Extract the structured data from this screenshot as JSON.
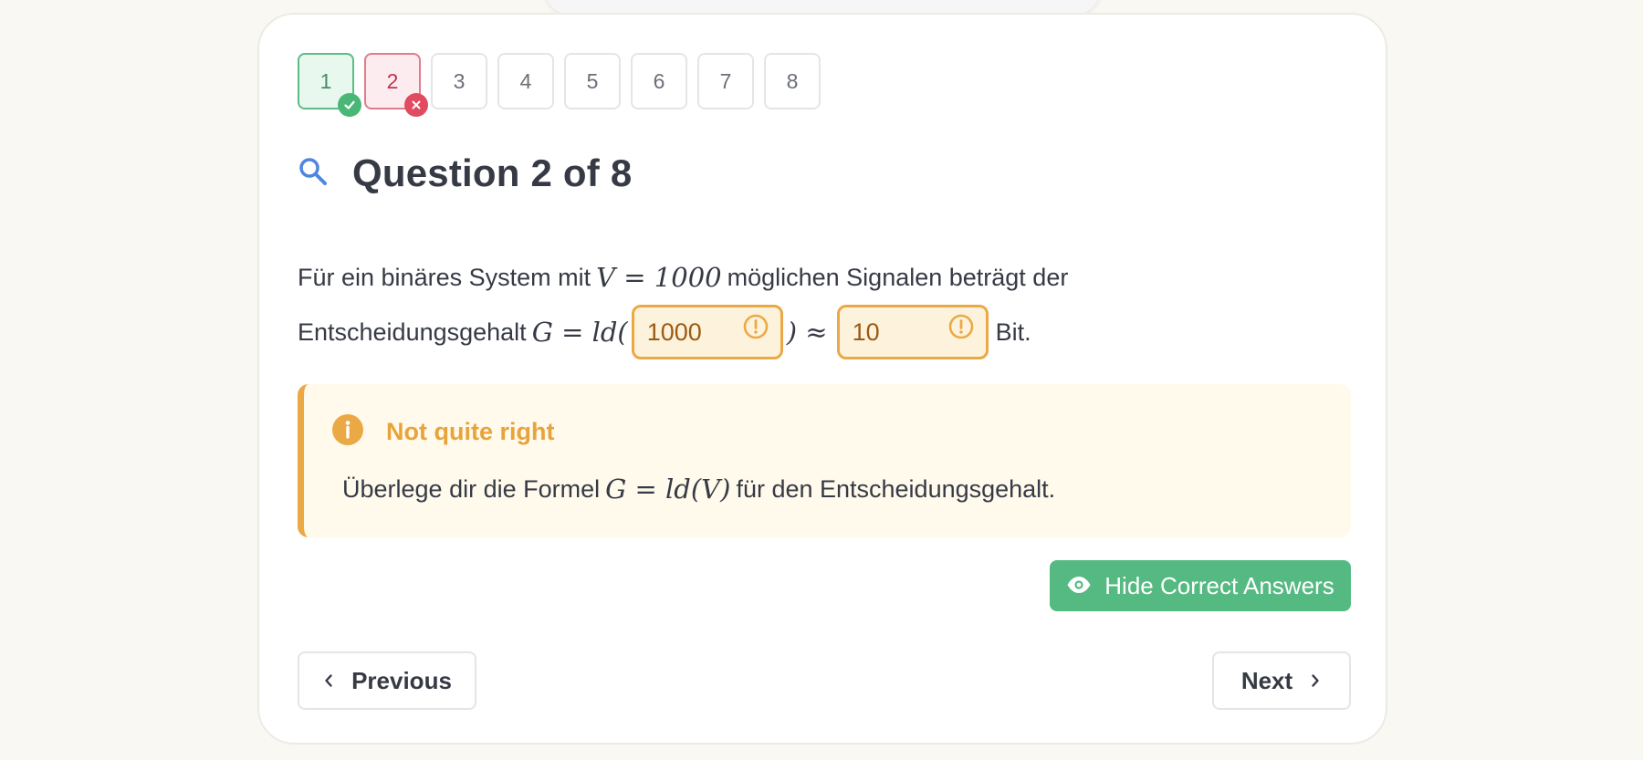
{
  "quiz": {
    "question_tabs": [
      {
        "label": "1",
        "state": "correct"
      },
      {
        "label": "2",
        "state": "wrong"
      },
      {
        "label": "3",
        "state": "unanswered"
      },
      {
        "label": "4",
        "state": "unanswered"
      },
      {
        "label": "5",
        "state": "unanswered"
      },
      {
        "label": "6",
        "state": "unanswered"
      },
      {
        "label": "7",
        "state": "unanswered"
      },
      {
        "label": "8",
        "state": "unanswered"
      }
    ],
    "title": "Question 2 of 8",
    "title_icon": "search-icon"
  },
  "question": {
    "text_part1": "Für ein binäres System mit",
    "math_v": "V = 1000",
    "text_part2": "möglichen Signalen beträgt der",
    "text_part3": "Entscheidungsgehalt",
    "math_g": "G = ld(",
    "blank1_value": "1000",
    "math_approx": ") ≈",
    "blank2_value": "10",
    "text_part4": "Bit."
  },
  "feedback": {
    "title": "Not quite right",
    "text_part1": "Überlege dir die Formel",
    "math_formula": "G = ld(V)",
    "text_part2": "für den Entscheidungsgehalt.",
    "icon": "info-icon"
  },
  "actions": {
    "hide_answers_label": "Hide Correct Answers",
    "previous_label": "Previous",
    "next_label": "Next"
  },
  "colors": {
    "correct": "#4bb776",
    "wrong": "#e14b62",
    "warning": "#eba945",
    "primary_green": "#55b982"
  }
}
